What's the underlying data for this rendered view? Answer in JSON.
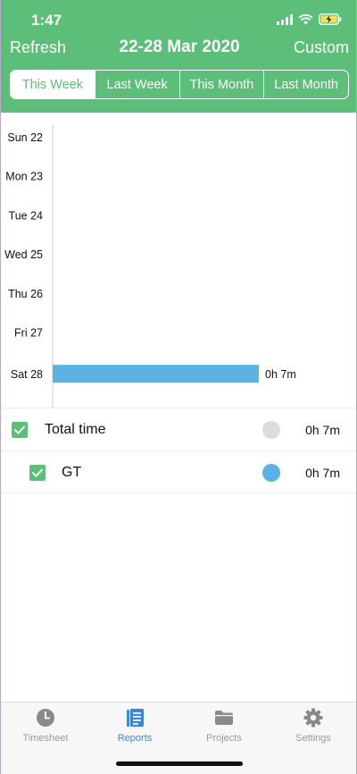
{
  "colors": {
    "brand_green": "#5cbe78",
    "bar_blue": "#5bb2e4",
    "total_dot_gray": "#dcdcdc",
    "tab_active": "#3a86d8",
    "tab_inactive": "#9a9a9a"
  },
  "status_bar": {
    "time": "1:47",
    "icons": [
      "signal-icon",
      "wifi-icon",
      "battery-charging-icon"
    ]
  },
  "header": {
    "refresh_label": "Refresh",
    "title": "22-28 Mar 2020",
    "custom_label": "Custom"
  },
  "segments": [
    {
      "label": "This Week",
      "active": true
    },
    {
      "label": "Last Week",
      "active": false
    },
    {
      "label": "This Month",
      "active": false
    },
    {
      "label": "Last Month",
      "active": false
    }
  ],
  "chart_data": {
    "type": "bar",
    "orientation": "horizontal",
    "categories": [
      "Sun 22",
      "Mon 23",
      "Tue 24",
      "Wed 25",
      "Thu 26",
      "Fri 27",
      "Sat 28"
    ],
    "values_minutes": [
      0,
      0,
      0,
      0,
      0,
      0,
      7
    ],
    "value_labels": [
      "",
      "",
      "",
      "",
      "",
      "",
      "0h 7m"
    ],
    "series": [
      {
        "name": "GT",
        "color": "#5bb2e4"
      }
    ],
    "xlim_minutes": [
      0,
      7
    ],
    "grid": false
  },
  "legend": [
    {
      "label": "Total time",
      "value": "0h 7m",
      "dot_color": "#dcdcdc",
      "checked": true,
      "indent": false
    },
    {
      "label": "GT",
      "value": "0h 7m",
      "dot_color": "#5bb2e4",
      "checked": true,
      "indent": true
    }
  ],
  "tabs": [
    {
      "label": "Timesheet",
      "icon": "clock-icon",
      "active": false
    },
    {
      "label": "Reports",
      "icon": "reports-icon",
      "active": true
    },
    {
      "label": "Projects",
      "icon": "folder-icon",
      "active": false
    },
    {
      "label": "Settings",
      "icon": "gear-icon",
      "active": false
    }
  ]
}
